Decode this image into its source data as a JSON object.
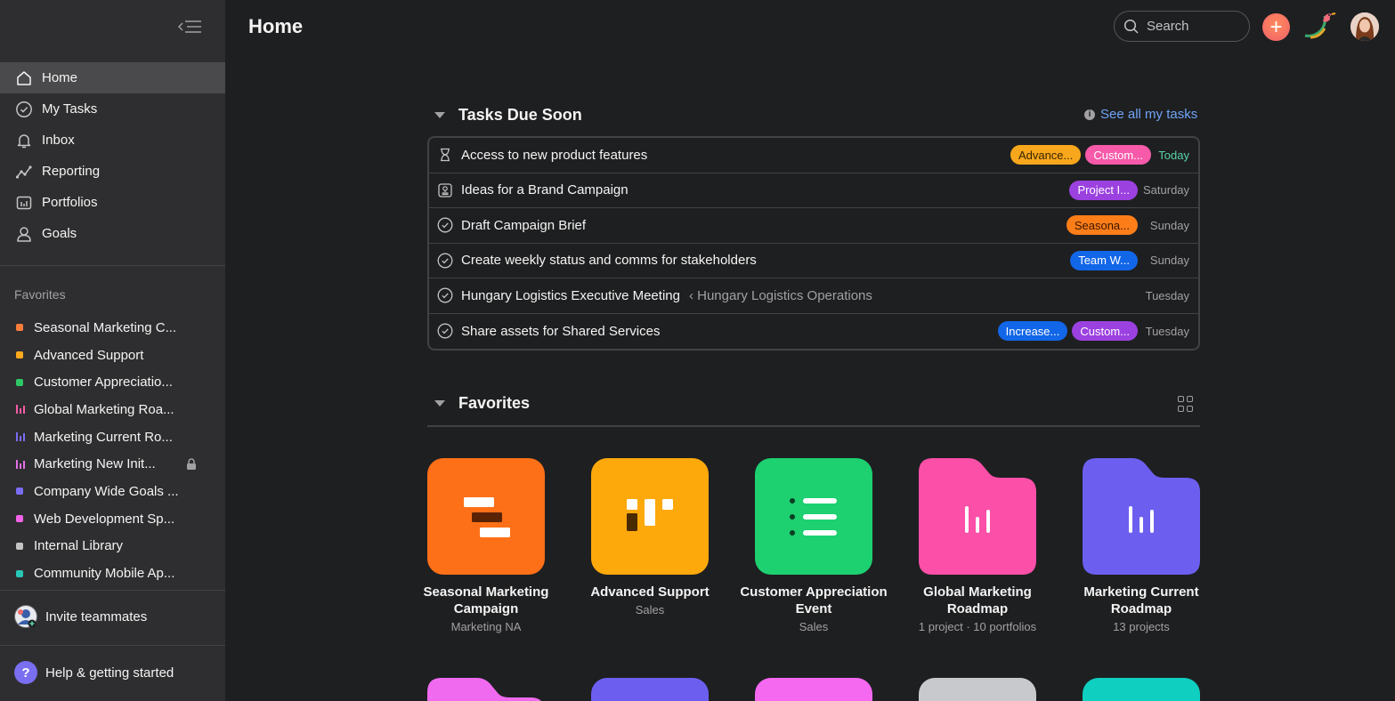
{
  "header": {
    "title": "Home",
    "search_placeholder": "Search"
  },
  "sidebar": {
    "nav": [
      {
        "label": "Home",
        "icon": "home-icon",
        "active": true
      },
      {
        "label": "My Tasks",
        "icon": "check-circle-icon"
      },
      {
        "label": "Inbox",
        "icon": "bell-icon"
      },
      {
        "label": "Reporting",
        "icon": "chart-line-icon"
      },
      {
        "label": "Portfolios",
        "icon": "portfolio-icon"
      },
      {
        "label": "Goals",
        "icon": "person-icon"
      }
    ],
    "favorites_title": "Favorites",
    "favorites": [
      {
        "label": "Seasonal Marketing C...",
        "kind": "dot",
        "color": "#fd7e3c"
      },
      {
        "label": "Advanced Support",
        "kind": "dot",
        "color": "#fdaa1c"
      },
      {
        "label": "Customer Appreciatio...",
        "kind": "dot",
        "color": "#2ec767"
      },
      {
        "label": "Global Marketing Roa...",
        "kind": "bars",
        "color": "#f75ba3"
      },
      {
        "label": "Marketing Current Ro...",
        "kind": "bars",
        "color": "#7b6cf5"
      },
      {
        "label": "Marketing New Init...",
        "kind": "bars",
        "color": "#e36fe6",
        "locked": true
      },
      {
        "label": "Company Wide Goals ...",
        "kind": "dot",
        "color": "#7b6cf5"
      },
      {
        "label": "Web Development Sp...",
        "kind": "dot",
        "color": "#f263e8"
      },
      {
        "label": "Internal Library",
        "kind": "dot",
        "color": "#c4c3c4"
      },
      {
        "label": "Community Mobile Ap...",
        "kind": "dot",
        "color": "#27c7b6"
      }
    ],
    "invite_label": "Invite teammates",
    "help_label": "Help & getting started"
  },
  "tasks_section": {
    "title": "Tasks Due Soon",
    "see_all": "See all my tasks",
    "tasks": [
      {
        "name": "Access to new product features",
        "icon": "hourglass-icon",
        "tags": [
          {
            "text": "Advance...",
            "bg": "#f8a71c",
            "fg": "#3a2400"
          },
          {
            "text": "Custom...",
            "bg": "#f65aa9",
            "fg": "#ffffff"
          }
        ],
        "due": "Today",
        "today": true
      },
      {
        "name": "Ideas for a Brand Campaign",
        "icon": "approval-icon",
        "tags": [
          {
            "text": "Project I...",
            "bg": "#9b41e0",
            "fg": "#ffffff"
          }
        ],
        "due": "Saturday"
      },
      {
        "name": "Draft Campaign Brief",
        "icon": "check-circle-icon",
        "tags": [
          {
            "text": "Seasona...",
            "bg": "#fd7e18",
            "fg": "#3a1600"
          }
        ],
        "due": "Sunday"
      },
      {
        "name": "Create weekly status and comms for stakeholders",
        "icon": "check-circle-icon",
        "tags": [
          {
            "text": "Team W...",
            "bg": "#1266e8",
            "fg": "#ffffff"
          }
        ],
        "due": "Sunday"
      },
      {
        "name": "Hungary Logistics Executive Meeting",
        "crumb": "‹ Hungary Logistics Operations",
        "icon": "check-circle-icon",
        "tags": [],
        "due": "Tuesday"
      },
      {
        "name": "Share assets for Shared Services",
        "icon": "check-circle-icon",
        "tags": [
          {
            "text": "Increase...",
            "bg": "#1266e8",
            "fg": "#ffffff"
          },
          {
            "text": "Custom...",
            "bg": "#9b41e0",
            "fg": "#ffffff"
          }
        ],
        "due": "Tuesday"
      }
    ]
  },
  "favorites_section": {
    "title": "Favorites",
    "tiles": [
      {
        "name": "Seasonal Marketing Campaign",
        "sub": "Marketing NA",
        "color": "#fd7018",
        "icon": "timeline-icon"
      },
      {
        "name": "Advanced Support",
        "sub": "Sales",
        "color": "#fda90b",
        "icon": "board-icon"
      },
      {
        "name": "Customer Appreciation Event",
        "sub": "Sales",
        "color": "#1dd070",
        "icon": "list-icon"
      },
      {
        "name": "Global Marketing Roadmap",
        "sub": "1 project · 10 portfolios",
        "color": "#fb4fa8",
        "icon": "portfolio-bars-icon"
      },
      {
        "name": "Marketing Current Roadmap",
        "sub": "13 projects",
        "color": "#6c5ff0",
        "icon": "portfolio-bars-icon"
      }
    ],
    "row2_colors": [
      "#f06af0",
      "#6c5ff0",
      "#f568f0",
      "#c8c9cc",
      "#0fcfc0"
    ]
  }
}
